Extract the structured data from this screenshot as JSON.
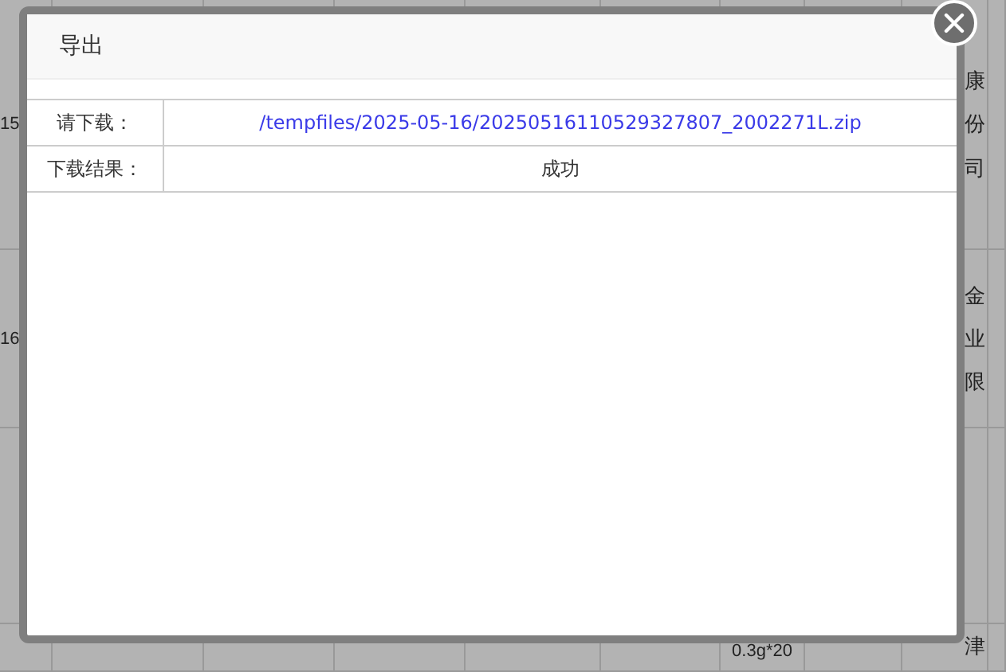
{
  "background_table": {
    "rows": [
      {
        "column_1": "15",
        "column_7": "",
        "column_9": "康份司"
      },
      {
        "column_1": "16",
        "column_7": "",
        "column_9": "金业限"
      },
      {
        "column_1": "",
        "column_7": "0.3g*20",
        "column_9": "津"
      }
    ]
  },
  "dialog": {
    "title": "导出",
    "rows": [
      {
        "label": "请下载：",
        "value": "/tempfiles/2025-05-16/20250516110529327807_2002271L.zip",
        "kind": "link"
      },
      {
        "label": "下载结果：",
        "value": "成功",
        "kind": "text"
      }
    ]
  }
}
